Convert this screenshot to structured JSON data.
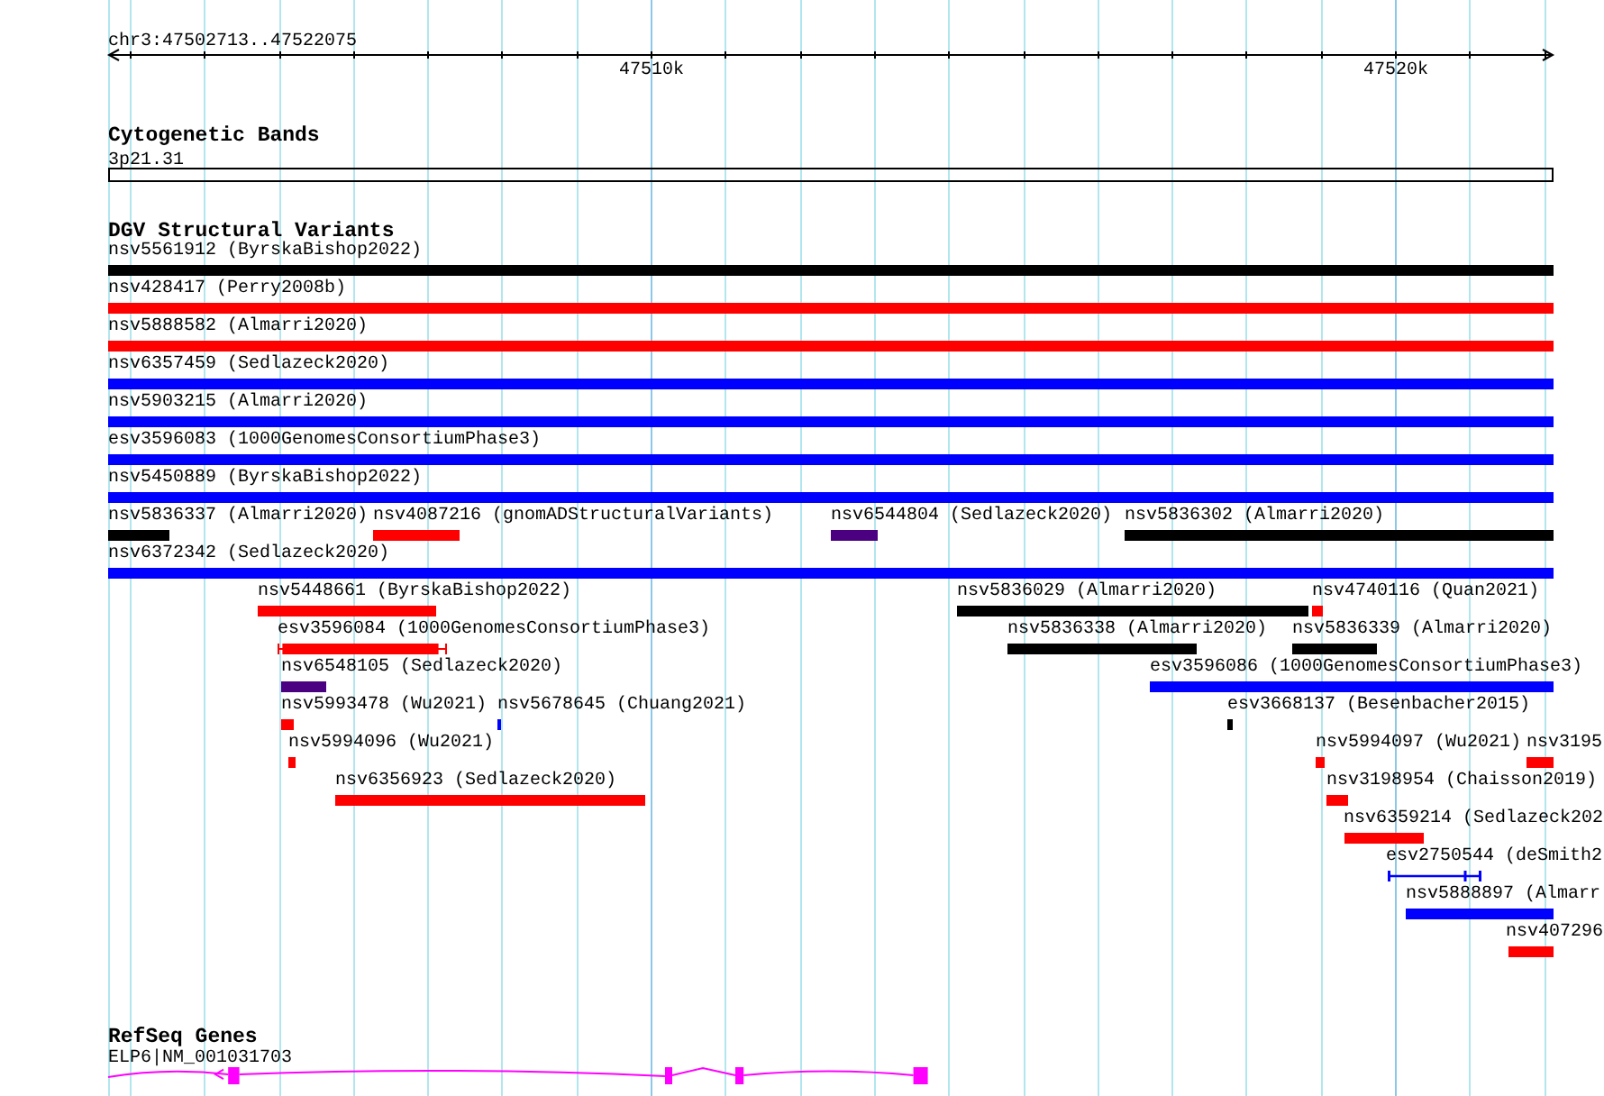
{
  "ruler": {
    "range": "chr3:47502713..47522075",
    "tick_labels": [
      "47510k",
      "47520k"
    ]
  },
  "tracks": [
    {
      "kind": "bands",
      "title": "Cytogenetic Bands",
      "features": [
        {
          "label": "3p21.31"
        }
      ]
    },
    {
      "kind": "variants",
      "title": "DGV Structural Variants",
      "rows": [
        {
          "features": [
            {
              "label": "nsv5561912 (ByrskaBishop2022)",
              "color": "#000000",
              "kind": "solid"
            }
          ]
        },
        {
          "features": [
            {
              "label": "nsv428417 (Perry2008b)",
              "color": "#ff0000",
              "kind": "solid"
            }
          ]
        },
        {
          "features": [
            {
              "label": "nsv5888582 (Almarri2020)",
              "color": "#ff0000",
              "kind": "solid"
            }
          ]
        },
        {
          "features": [
            {
              "label": "nsv6357459 (Sedlazeck2020)",
              "color": "#0000ff",
              "kind": "solid"
            }
          ]
        },
        {
          "features": [
            {
              "label": "nsv5903215 (Almarri2020)",
              "color": "#0000ff",
              "kind": "solid"
            }
          ]
        },
        {
          "features": [
            {
              "label": "esv3596083 (1000GenomesConsortiumPhase3)",
              "color": "#0000ff",
              "kind": "solid"
            }
          ]
        },
        {
          "features": [
            {
              "label": "nsv5450889 (ByrskaBishop2022)",
              "color": "#0000ff",
              "kind": "solid"
            }
          ]
        },
        {
          "features": [
            {
              "label": "nsv5836337 (Almarri2020)",
              "color": "#000000",
              "kind": "solid"
            },
            {
              "label": "nsv4087216 (gnomADStructuralVariants)",
              "color": "#ff0000",
              "kind": "solid"
            },
            {
              "label": "nsv6544804 (Sedlazeck2020)",
              "color": "#4b0082",
              "kind": "solid"
            },
            {
              "label": "nsv5836302 (Almarri2020)",
              "color": "#000000",
              "kind": "solid"
            }
          ]
        },
        {
          "features": [
            {
              "label": "nsv6372342 (Sedlazeck2020)",
              "color": "#0000ff",
              "kind": "solid"
            }
          ]
        },
        {
          "features": [
            {
              "label": "nsv5448661 (ByrskaBishop2022)",
              "color": "#ff0000",
              "kind": "solid"
            },
            {
              "label": "nsv5836029 (Almarri2020)",
              "color": "#000000",
              "kind": "solid"
            },
            {
              "label": "nsv4740116 (Quan2021)",
              "color": "#ff0000",
              "kind": "solid"
            }
          ]
        },
        {
          "features": [
            {
              "label": "esv3596084 (1000GenomesConsortiumPhase3)",
              "color": "#ff0000",
              "kind": "whiskered"
            },
            {
              "label": "nsv5836338 (Almarri2020)",
              "color": "#000000",
              "kind": "solid"
            },
            {
              "label": "nsv5836339 (Almarri2020)",
              "color": "#000000",
              "kind": "solid"
            }
          ]
        },
        {
          "features": [
            {
              "label": "nsv6548105 (Sedlazeck2020)",
              "color": "#4b0082",
              "kind": "solid"
            },
            {
              "label": "esv3596086 (1000GenomesConsortiumPhase3)",
              "color": "#0000ff",
              "kind": "solid"
            }
          ]
        },
        {
          "features": [
            {
              "label": "nsv5993478 (Wu2021)",
              "color": "#ff0000",
              "kind": "solid"
            },
            {
              "label": "nsv5678645 (Chuang2021)",
              "color": "#0000ff",
              "kind": "solid"
            },
            {
              "label": "esv3668137 (Besenbacher2015)",
              "color": "#000000",
              "kind": "solid"
            }
          ]
        },
        {
          "features": [
            {
              "label": "nsv5994096 (Wu2021)",
              "color": "#ff0000",
              "kind": "solid"
            },
            {
              "label": "nsv5994097 (Wu2021)",
              "color": "#ff0000",
              "kind": "solid"
            },
            {
              "label": "nsv3195",
              "color": "#ff0000",
              "kind": "solid"
            }
          ]
        },
        {
          "features": [
            {
              "label": "nsv6356923 (Sedlazeck2020)",
              "color": "#ff0000",
              "kind": "solid"
            },
            {
              "label": "nsv3198954 (Chaisson2019)",
              "color": "#ff0000",
              "kind": "solid"
            }
          ]
        },
        {
          "features": [
            {
              "label": "nsv6359214 (Sedlazeck202",
              "color": "#ff0000",
              "kind": "solid"
            }
          ]
        },
        {
          "features": [
            {
              "label": "esv2750544 (deSmith2",
              "color": "#0000ff",
              "kind": "thin"
            }
          ]
        },
        {
          "features": [
            {
              "label": "nsv5888897 (Almarr",
              "color": "#0000ff",
              "kind": "solid"
            }
          ]
        },
        {
          "features": [
            {
              "label": "nsv407296",
              "color": "#ff0000",
              "kind": "solid"
            }
          ]
        }
      ]
    },
    {
      "kind": "genes",
      "title": "RefSeq Genes",
      "features": [
        {
          "label": "ELP6|NM_001031703"
        }
      ]
    }
  ]
}
